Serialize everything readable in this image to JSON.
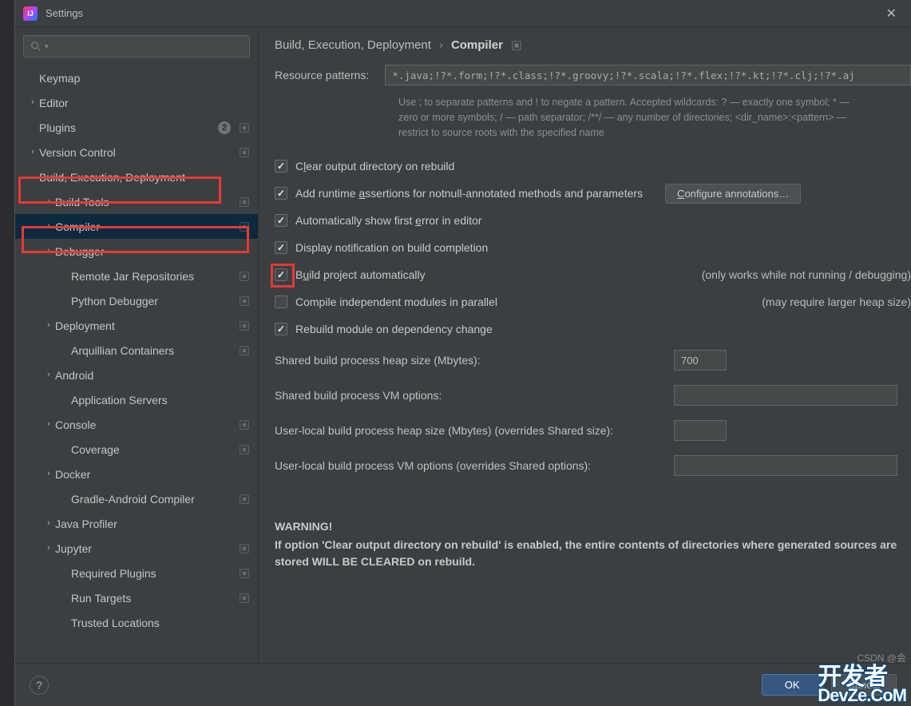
{
  "window": {
    "title": "Settings"
  },
  "search": {
    "placeholder": ""
  },
  "sidebar": {
    "items": [
      {
        "label": "Keymap",
        "expandable": false,
        "depth": 0,
        "gear": false
      },
      {
        "label": "Editor",
        "expandable": true,
        "expanded": false,
        "depth": 0,
        "gear": false
      },
      {
        "label": "Plugins",
        "expandable": false,
        "depth": 0,
        "gear": true,
        "badge": "2"
      },
      {
        "label": "Version Control",
        "expandable": true,
        "expanded": false,
        "depth": 0,
        "gear": true
      },
      {
        "label": "Build, Execution, Deployment",
        "expandable": true,
        "expanded": true,
        "depth": 0,
        "gear": false,
        "highlight": true
      },
      {
        "label": "Build Tools",
        "expandable": true,
        "expanded": false,
        "depth": 1,
        "gear": true
      },
      {
        "label": "Compiler",
        "expandable": true,
        "expanded": false,
        "depth": 1,
        "gear": true,
        "selected": true,
        "highlight": true
      },
      {
        "label": "Debugger",
        "expandable": true,
        "expanded": false,
        "depth": 1,
        "gear": false
      },
      {
        "label": "Remote Jar Repositories",
        "expandable": false,
        "depth": 2,
        "gear": true
      },
      {
        "label": "Python Debugger",
        "expandable": false,
        "depth": 2,
        "gear": true
      },
      {
        "label": "Deployment",
        "expandable": true,
        "expanded": false,
        "depth": 1,
        "gear": true
      },
      {
        "label": "Arquillian Containers",
        "expandable": false,
        "depth": 2,
        "gear": true
      },
      {
        "label": "Android",
        "expandable": true,
        "expanded": false,
        "depth": 1,
        "gear": false
      },
      {
        "label": "Application Servers",
        "expandable": false,
        "depth": 2,
        "gear": false
      },
      {
        "label": "Console",
        "expandable": true,
        "expanded": false,
        "depth": 1,
        "gear": true
      },
      {
        "label": "Coverage",
        "expandable": false,
        "depth": 2,
        "gear": true
      },
      {
        "label": "Docker",
        "expandable": true,
        "expanded": false,
        "depth": 1,
        "gear": false
      },
      {
        "label": "Gradle-Android Compiler",
        "expandable": false,
        "depth": 2,
        "gear": true
      },
      {
        "label": "Java Profiler",
        "expandable": true,
        "expanded": false,
        "depth": 1,
        "gear": false
      },
      {
        "label": "Jupyter",
        "expandable": true,
        "expanded": false,
        "depth": 1,
        "gear": true
      },
      {
        "label": "Required Plugins",
        "expandable": false,
        "depth": 2,
        "gear": true
      },
      {
        "label": "Run Targets",
        "expandable": false,
        "depth": 2,
        "gear": true
      },
      {
        "label": "Trusted Locations",
        "expandable": false,
        "depth": 2,
        "gear": false
      }
    ]
  },
  "breadcrumb": {
    "parent": "Build, Execution, Deployment",
    "current": "Compiler"
  },
  "resource": {
    "label": "Resource patterns:",
    "value": "*.java;!?*.form;!?*.class;!?*.groovy;!?*.scala;!?*.flex;!?*.kt;!?*.clj;!?*.aj",
    "help_lines": [
      "Use ; to separate patterns and ! to negate a pattern. Accepted wildcards: ? — exactly one symbol; * —",
      "zero or more symbols; / — path separator; /**/ — any number of directories; <dir_name>:<pattern> —",
      "restrict to source roots with the specified name"
    ]
  },
  "checks": {
    "clear_output": {
      "label_pre": "C",
      "label_u": "l",
      "label_post": "ear output directory on rebuild",
      "checked": true
    },
    "add_runtime": {
      "label_pre": "Add runtime ",
      "label_u": "a",
      "label_post": "ssertions for notnull-annotated methods and parameters",
      "checked": true,
      "button": "Configure annotations…"
    },
    "auto_first_error": {
      "label_pre": "Automatically show first ",
      "label_u": "e",
      "label_post": "rror in editor",
      "checked": true
    },
    "display_notif": {
      "label": "Display notification on build completion",
      "checked": true
    },
    "build_auto": {
      "label_pre": "B",
      "label_u": "u",
      "label_post": "ild project automatically",
      "checked": true,
      "note": "(only works while not running / debugging)",
      "highlight": true
    },
    "compile_parallel": {
      "label": "Compile independent modules in parallel",
      "checked": false,
      "note": "(may require larger heap size)"
    },
    "rebuild_dep": {
      "label": "Rebuild module on dependency change",
      "checked": true
    }
  },
  "fields": {
    "heap_size": {
      "label": "Shared build process heap size (Mbytes):",
      "value": "700"
    },
    "vm_options": {
      "label": "Shared build process VM options:",
      "value": ""
    },
    "user_heap": {
      "label": "User-local build process heap size (Mbytes) (overrides Shared size):",
      "value": ""
    },
    "user_vm": {
      "label": "User-local build process VM options (overrides Shared options):",
      "value": ""
    }
  },
  "warning": {
    "title": "WARNING!",
    "body": "If option 'Clear output directory on rebuild' is enabled, the entire contents of directories where generated sources are stored WILL BE CLEARED on rebuild."
  },
  "footer": {
    "ok": "OK",
    "cancel": "Cancel"
  },
  "watermark": {
    "big": "开发者",
    "brand": "DevZe.CoM",
    "csdn": "CSDN @会"
  }
}
